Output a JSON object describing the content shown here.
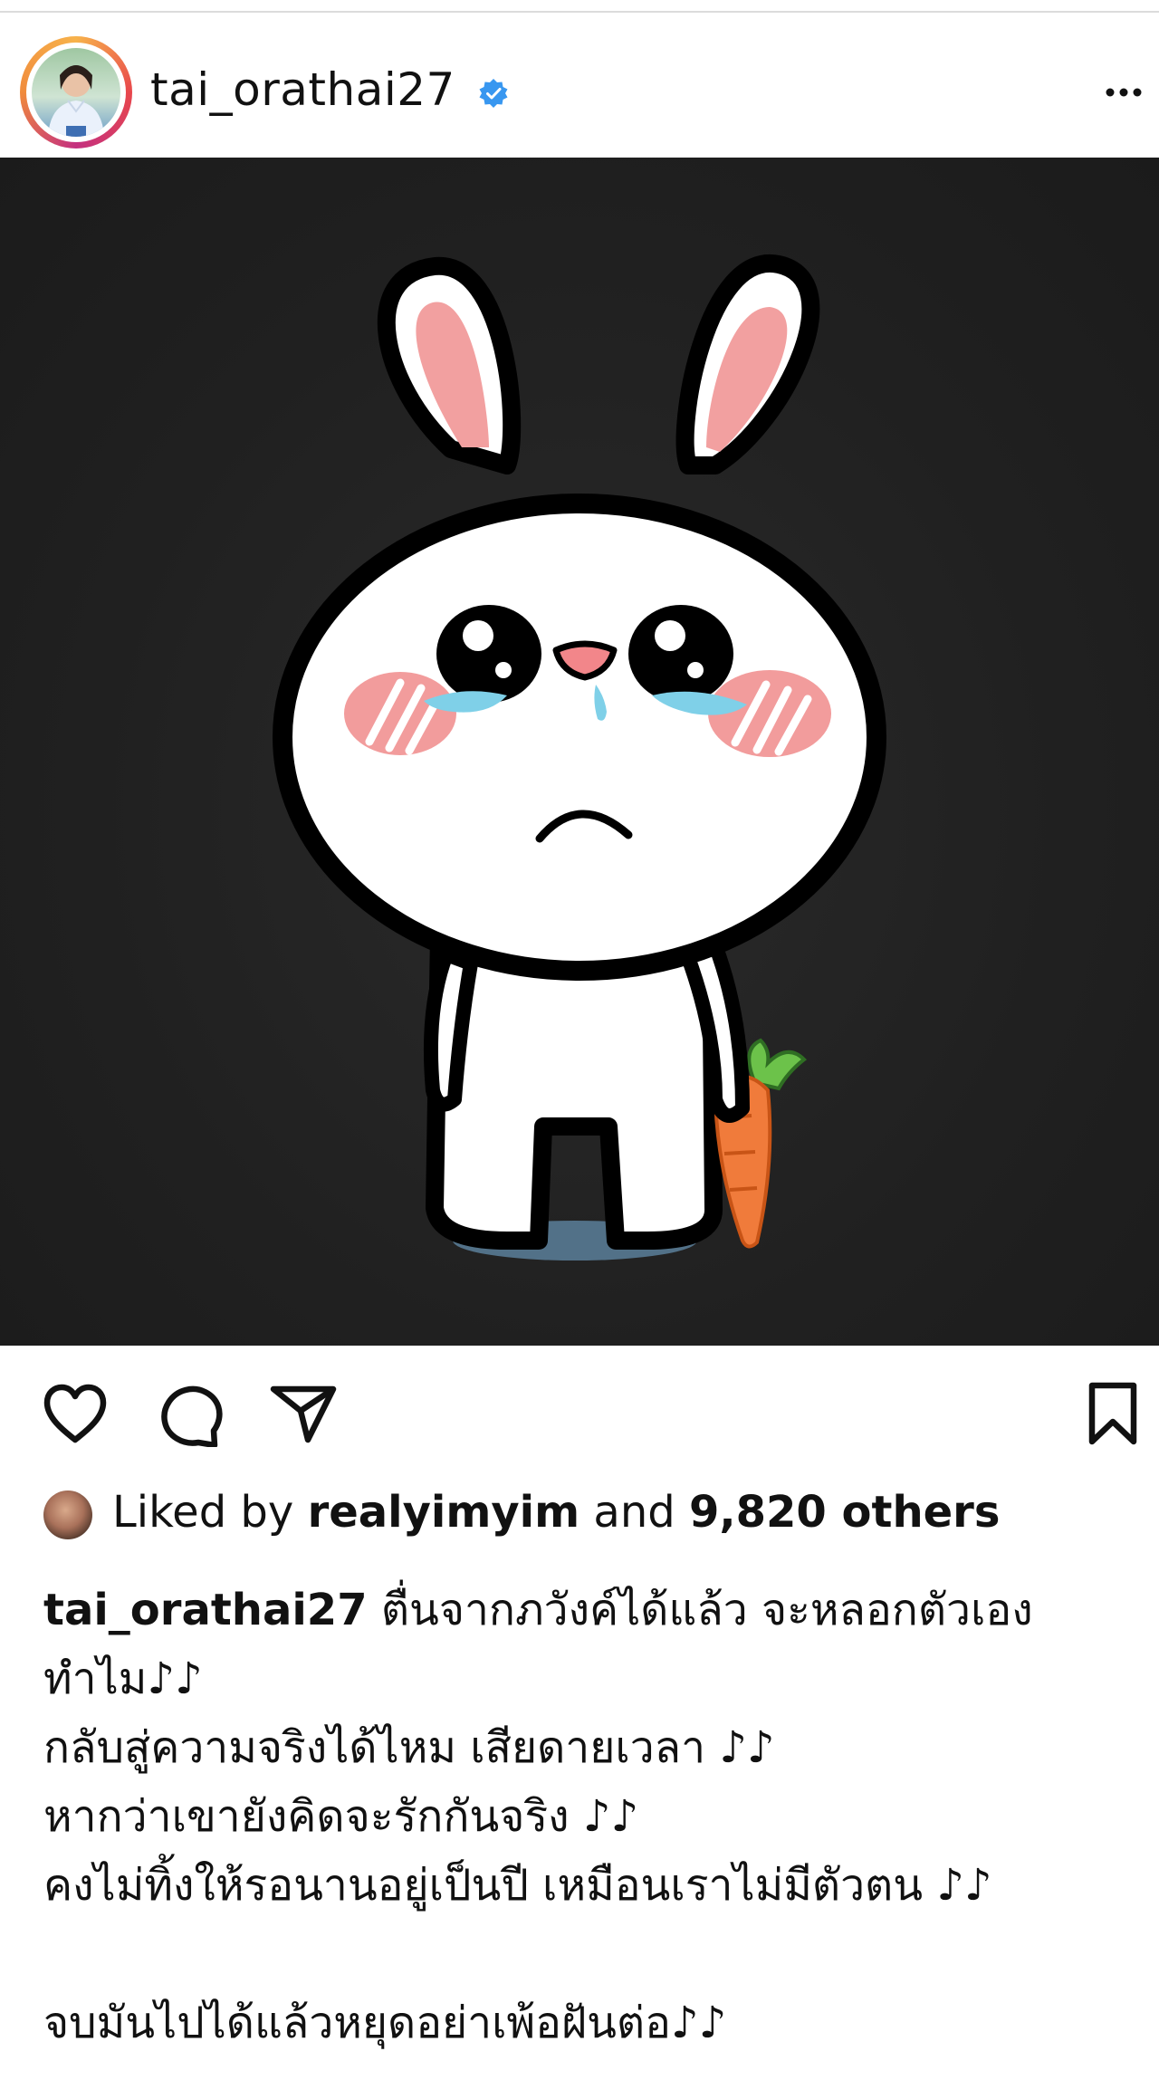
{
  "post": {
    "username": "tai_orathai27",
    "verified_icon": "verified-badge-icon",
    "more_icon": "more-options-icon",
    "image": {
      "subject": "crying-bunny-holding-carrot",
      "colors": {
        "background": "#1f1f1f",
        "bunny": "#ffffff",
        "outline": "#000000",
        "ear_inner": "#f2a0a0",
        "cheek": "#f29c9c",
        "tears": "#7fd0e8",
        "carrot": "#f07b3b",
        "carrot_leaves": "#6cc24a",
        "shadow": "#5a7f9a"
      }
    }
  },
  "actions": {
    "like_icon": "heart-icon",
    "comment_icon": "comment-icon",
    "share_icon": "share-icon",
    "save_icon": "bookmark-icon"
  },
  "likes": {
    "prefix": "Liked by ",
    "user": "realyimyim",
    "middle": " and ",
    "count": "9,820 others"
  },
  "caption": {
    "username": "tai_orathai27",
    "lines": [
      " ตื่นจากภวังค์ได้แล้ว จะหลอกตัวเอง",
      "ทำไม♪♪",
      "กลับสู่ความจริงได้ไหม เสียดายเวลา ♪♪",
      "หากว่าเขายังคิดจะรักกันจริง ♪♪",
      "คงไม่ทิ้งให้รอนานอยู่เป็นปี เหมือนเราไม่มีตัวตน ♪♪",
      "",
      "จบมันไปได้แล้วหยุดอย่าเพ้อฝันต่อ♪♪"
    ]
  }
}
